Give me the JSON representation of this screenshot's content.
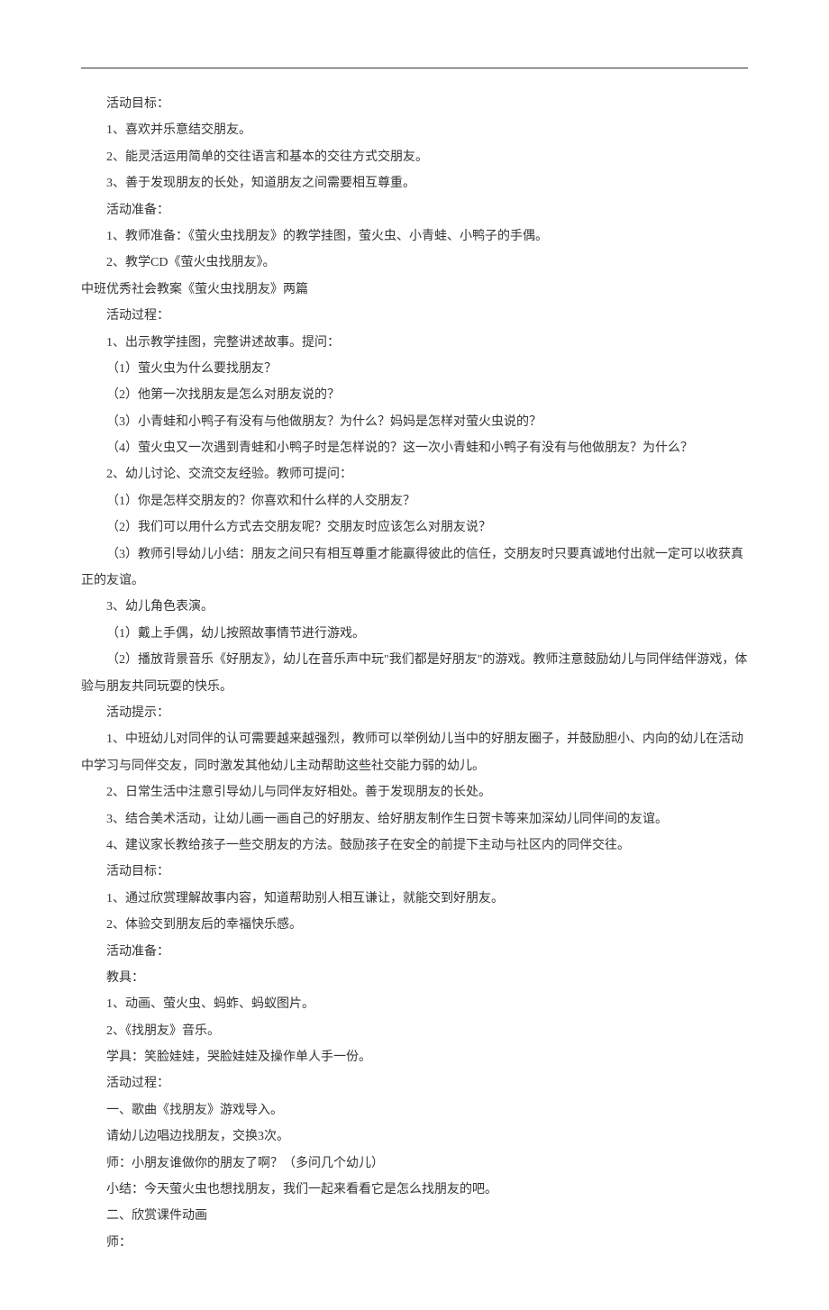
{
  "lines": [
    {
      "text": "活动目标：",
      "indent": true
    },
    {
      "text": "1、喜欢并乐意结交朋友。",
      "indent": true
    },
    {
      "text": "2、能灵活运用简单的交往语言和基本的交往方式交朋友。",
      "indent": true
    },
    {
      "text": "3、善于发现朋友的长处，知道朋友之间需要相互尊重。",
      "indent": true
    },
    {
      "text": "活动准备：",
      "indent": true
    },
    {
      "text": "1、教师准备：《萤火虫找朋友》的教学挂图，萤火虫、小青蛙、小鸭子的手偶。",
      "indent": true
    },
    {
      "text": "2、教学CD《萤火虫找朋友》。",
      "indent": true
    },
    {
      "text": "中班优秀社会教案《萤火虫找朋友》两篇",
      "indent": false
    },
    {
      "text": "活动过程：",
      "indent": true
    },
    {
      "text": "1、出示教学挂图，完整讲述故事。提问：",
      "indent": true
    },
    {
      "text": "（1）萤火虫为什么要找朋友？",
      "indent": true
    },
    {
      "text": "（2）他第一次找朋友是怎么对朋友说的？",
      "indent": true
    },
    {
      "text": "（3）小青蛙和小鸭子有没有与他做朋友？为什么？妈妈是怎样对萤火虫说的？",
      "indent": true
    },
    {
      "text": "（4）萤火虫又一次遇到青蛙和小鸭子时是怎样说的？这一次小青蛙和小鸭子有没有与他做朋友？为什么？",
      "indent": true
    },
    {
      "text": "2、幼儿讨论、交流交友经验。教师可提问：",
      "indent": true
    },
    {
      "text": "（1）你是怎样交朋友的？你喜欢和什么样的人交朋友？",
      "indent": true
    },
    {
      "text": "（2）我们可以用什么方式去交朋友呢？交朋友时应该怎么对朋友说？",
      "indent": true
    },
    {
      "text": "（3）教师引导幼儿小结：朋友之间只有相互尊重才能赢得彼此的信任，交朋友时只要真诚地付出就一定可以收获真正的友谊。",
      "indent": true
    },
    {
      "text": "3、幼儿角色表演。",
      "indent": true
    },
    {
      "text": "（1）戴上手偶，幼儿按照故事情节进行游戏。",
      "indent": true
    },
    {
      "text": "（2）播放背景音乐《好朋友》，幼儿在音乐声中玩\"我们都是好朋友\"的游戏。教师注意鼓励幼儿与同伴结伴游戏，体验与朋友共同玩耍的快乐。",
      "indent": true
    },
    {
      "text": "活动提示：",
      "indent": true
    },
    {
      "text": "1、中班幼儿对同伴的认可需要越来越强烈，教师可以举例幼儿当中的好朋友圈子，并鼓励胆小、内向的幼儿在活动中学习与同伴交友，同时激发其他幼儿主动帮助这些社交能力弱的幼儿。",
      "indent": true
    },
    {
      "text": "2、日常生活中注意引导幼儿与同伴友好相处。善于发现朋友的长处。",
      "indent": true
    },
    {
      "text": "3、结合美术活动，让幼儿画一画自己的好朋友、给好朋友制作生日贺卡等来加深幼儿同伴间的友谊。",
      "indent": true
    },
    {
      "text": "4、建议家长教给孩子一些交朋友的方法。鼓励孩子在安全的前提下主动与社区内的同伴交往。",
      "indent": true
    },
    {
      "text": "活动目标：",
      "indent": true
    },
    {
      "text": "1、通过欣赏理解故事内容，知道帮助别人相互谦让，就能交到好朋友。",
      "indent": true
    },
    {
      "text": "2、体验交到朋友后的幸福快乐感。",
      "indent": true
    },
    {
      "text": "活动准备：",
      "indent": true
    },
    {
      "text": "教具：",
      "indent": true
    },
    {
      "text": "1、动画、萤火虫、蚂蚱、蚂蚁图片。",
      "indent": true
    },
    {
      "text": "2、《找朋友》音乐。",
      "indent": true
    },
    {
      "text": "学具：笑脸娃娃，哭脸娃娃及操作单人手一份。",
      "indent": true
    },
    {
      "text": "活动过程：",
      "indent": true
    },
    {
      "text": "一、歌曲《找朋友》游戏导入。",
      "indent": true
    },
    {
      "text": "请幼儿边唱边找朋友，交换3次。",
      "indent": true
    },
    {
      "text": "师：小朋友谁做你的朋友了啊？（多问几个幼儿）",
      "indent": true
    },
    {
      "text": "小结：今天萤火虫也想找朋友，我们一起来看看它是怎么找朋友的吧。",
      "indent": true
    },
    {
      "text": "二、欣赏课件动画",
      "indent": true
    },
    {
      "text": "师：",
      "indent": true
    }
  ]
}
